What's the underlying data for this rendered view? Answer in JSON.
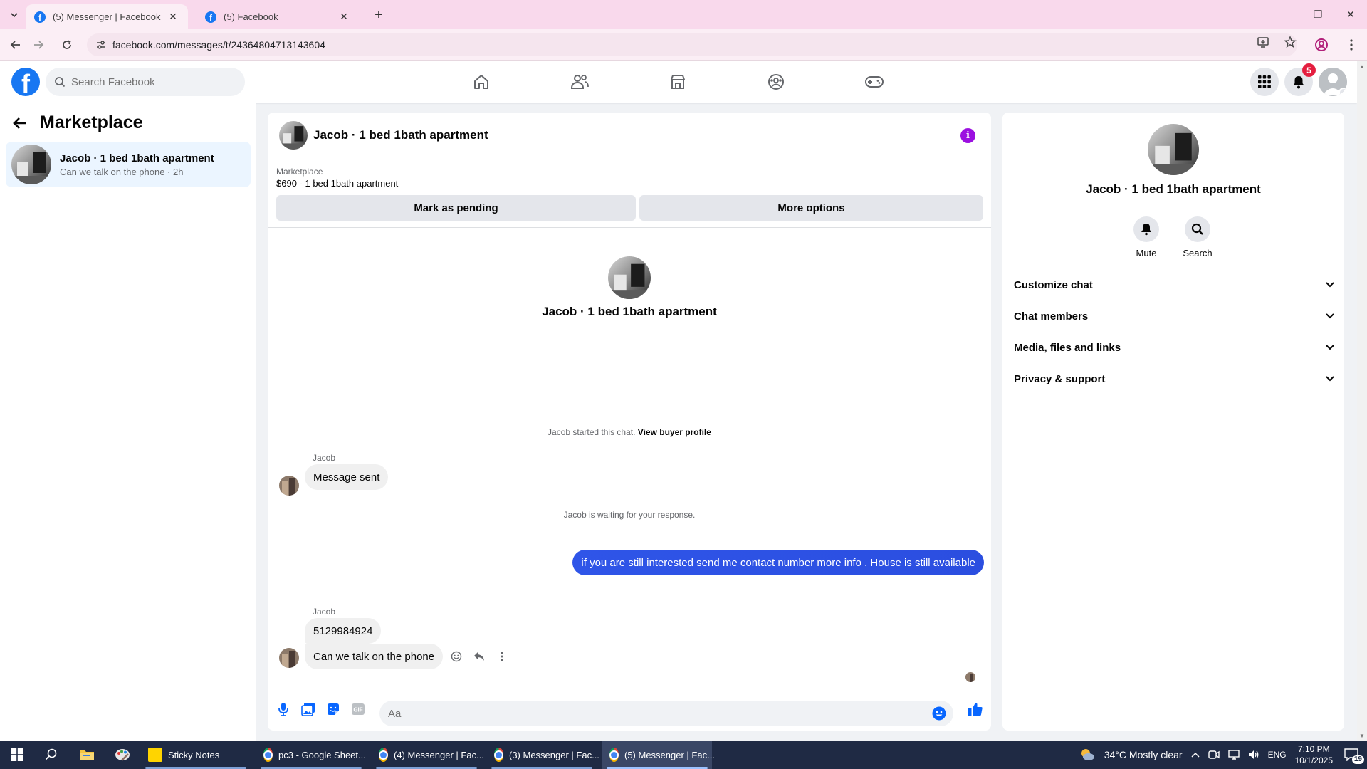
{
  "browser": {
    "tabs": [
      {
        "title": "(5) Messenger | Facebook",
        "active": true
      },
      {
        "title": "(5) Facebook",
        "active": false
      }
    ],
    "url": "facebook.com/messages/t/24364804713143604"
  },
  "fb": {
    "search_placeholder": "Search Facebook",
    "notification_count": "5",
    "brand_color": "#1877f2"
  },
  "left": {
    "title": "Marketplace",
    "conversations": [
      {
        "name": "Jacob · 1 bed 1bath apartment",
        "preview": "Can we talk on the phone · 2h"
      }
    ]
  },
  "chat": {
    "title": "Jacob · 1 bed 1bath apartment",
    "marketplace_label": "Marketplace",
    "listing": "$690 - 1 bed 1bath apartment",
    "mark_pending": "Mark as pending",
    "more_options": "More options",
    "intro_title": "Jacob · 1 bed 1bath apartment",
    "started_text": "Jacob started this chat.",
    "view_buyer_profile": "View buyer profile",
    "sender_1": "Jacob",
    "msg_1": "Message sent",
    "waiting_text": "Jacob is waiting for your response.",
    "msg_out": "if you  are still interested send me contact number more info . House is still available",
    "sender_2": "Jacob",
    "msg_2": "5129984924",
    "msg_3": "Can we talk on the phone",
    "composer_placeholder": "Aa"
  },
  "info": {
    "title": "Jacob · 1 bed 1bath apartment",
    "mute": "Mute",
    "search": "Search",
    "sections": [
      "Customize chat",
      "Chat members",
      "Media, files and links",
      "Privacy & support"
    ]
  },
  "taskbar": {
    "apps": [
      "Sticky Notes",
      "pc3 - Google Sheet...",
      "(4) Messenger | Fac...",
      "(3) Messenger | Fac...",
      "(5) Messenger | Fac..."
    ],
    "weather": "34°C  Mostly clear",
    "lang": "ENG",
    "time": "7:10 PM",
    "date": "10/1/2025",
    "notif_count": "19"
  }
}
